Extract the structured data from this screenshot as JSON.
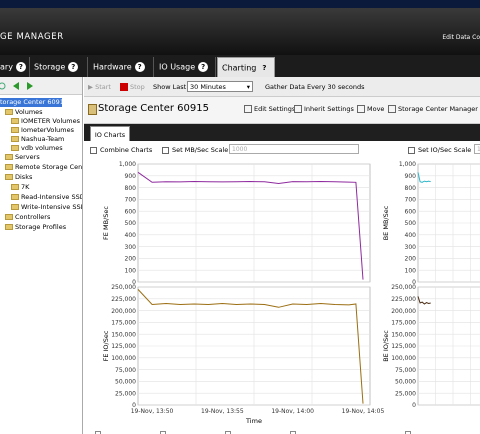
{
  "app": {
    "title": "GE MANAGER",
    "edit_contacts": "Edit Data Co"
  },
  "tabs": [
    {
      "label": "ary"
    },
    {
      "label": "Storage"
    },
    {
      "label": "Hardware"
    },
    {
      "label": "IO Usage"
    },
    {
      "label": "Charting"
    }
  ],
  "help_glyph": "?",
  "tree": [
    {
      "label": "torage Center 60915",
      "selected": true
    },
    {
      "label": "Volumes"
    },
    {
      "label": "IOMETER Volumes"
    },
    {
      "label": "IometerVolumes"
    },
    {
      "label": "Nashua-Team"
    },
    {
      "label": "vdb volumes"
    },
    {
      "label": "Servers"
    },
    {
      "label": "Remote Storage Centers"
    },
    {
      "label": "Disks"
    },
    {
      "label": "7K"
    },
    {
      "label": "Read-Intensive SSD"
    },
    {
      "label": "Write-Intensive SSD"
    },
    {
      "label": "Controllers"
    },
    {
      "label": "Storage Profiles"
    }
  ],
  "toolbar": {
    "start": "Start",
    "stop": "Stop",
    "show_last_label": "Show Last",
    "show_last_value": "30 Minutes",
    "gather": "Gather Data Every 30 seconds"
  },
  "header": {
    "title": "Storage Center 60915",
    "edit_settings": "Edit Settings",
    "inherit_settings": "Inherit Settings",
    "move": "Move",
    "sc_manager": "Storage Center Manager"
  },
  "io_tab": "IO Charts",
  "options": {
    "combine": "Combine Charts",
    "mb_scale": "Set MB/Sec Scale",
    "mb_scale_value": "1000",
    "io_scale": "Set IO/Sec Scale",
    "io_scale_value": "1"
  },
  "colors": {
    "fe_mb": "#8e2a9e",
    "fe_io": "#9b6e12",
    "be_mb": "#2bb5c8",
    "be_io": "#4a2a10"
  },
  "chart_data": [
    {
      "type": "line",
      "title": "",
      "ylabel": "FE MB/Sec",
      "xlabel": "",
      "ylim": [
        0,
        1000
      ],
      "yticks": [
        "1,000",
        "900",
        "800",
        "700",
        "600",
        "500",
        "400",
        "300",
        "200",
        "100",
        "0"
      ],
      "x_minutes": [
        0,
        1,
        2,
        3,
        4,
        5,
        6,
        7,
        8,
        9,
        10,
        11,
        12,
        13,
        14,
        15,
        15.5,
        16
      ],
      "series": [
        {
          "values": [
            930,
            845,
            850,
            848,
            852,
            850,
            848,
            850,
            852,
            849,
            835,
            851,
            850,
            852,
            850,
            847,
            845,
            20
          ]
        }
      ]
    },
    {
      "type": "line",
      "ylabel": "FE IO/Sec",
      "xlabel": "Time",
      "ylim": [
        0,
        250000
      ],
      "yticks": [
        "250,000",
        "225,000",
        "200,000",
        "175,000",
        "150,000",
        "125,000",
        "100,000",
        "75,000",
        "50,000",
        "25,000",
        "0"
      ],
      "xticks": [
        "19-Nov, 13:50",
        "19-Nov, 13:55",
        "19-Nov, 14:00",
        "19-Nov, 14:05"
      ],
      "x_minutes": [
        0,
        1,
        2,
        3,
        4,
        5,
        6,
        7,
        8,
        9,
        10,
        11,
        12,
        13,
        14,
        15,
        15.5,
        16
      ],
      "series": [
        {
          "values": [
            245000,
            213000,
            215000,
            213000,
            214000,
            213000,
            215000,
            213000,
            214000,
            213000,
            207000,
            214000,
            213000,
            215000,
            213000,
            212000,
            214000,
            3000
          ]
        }
      ]
    },
    {
      "type": "line",
      "ylabel": "BE MB/Sec",
      "ylim": [
        0,
        1000
      ],
      "yticks": [
        "1,000",
        "900",
        "800",
        "700",
        "600",
        "500",
        "400",
        "300",
        "200",
        "100",
        "0"
      ],
      "x_minutes": [
        0,
        0.5,
        1,
        1.5,
        2,
        2.5,
        3
      ],
      "series": [
        {
          "values": [
            930,
            850,
            845,
            855,
            850,
            855,
            850
          ]
        }
      ]
    },
    {
      "type": "line",
      "ylabel": "BE IO/Sec",
      "ylim": [
        0,
        250000
      ],
      "yticks": [
        "250,000",
        "225,000",
        "200,000",
        "175,000",
        "150,000",
        "125,000",
        "100,000",
        "75,000",
        "50,000",
        "25,000",
        "0"
      ],
      "x_minutes": [
        0,
        0.5,
        1,
        1.5,
        2,
        2.5,
        3
      ],
      "series": [
        {
          "values": [
            230000,
            216000,
            218000,
            214000,
            217000,
            215000,
            216000
          ]
        }
      ]
    }
  ]
}
